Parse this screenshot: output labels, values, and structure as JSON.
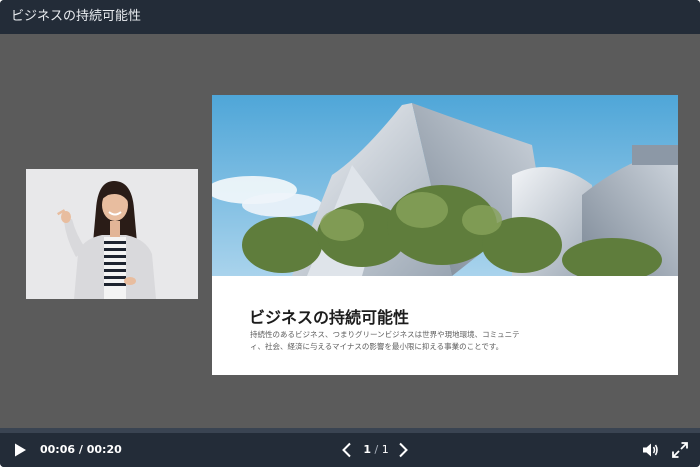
{
  "window": {
    "title": "ビジネスの持続可能性"
  },
  "slide": {
    "title": "ビジネスの持続可能性",
    "body": "持続性のあるビジネス、つまりグリーンビジネスは世界や現地環境、コミュニティ、社会、経済に与えるマイナスの影響を最小限に抑える事業のことです。",
    "image": "modern-architecture-photo"
  },
  "player": {
    "current_time": "00:06",
    "time_separator": "/",
    "duration": "00:20",
    "progress": 0.3,
    "page_current": "1",
    "page_separator": "/",
    "page_total": "1"
  },
  "icons": {
    "play": "play-icon",
    "prev": "chevron-left-icon",
    "next": "chevron-right-icon",
    "volume": "volume-icon",
    "fullscreen": "fullscreen-icon"
  },
  "colors": {
    "chrome": "#232c38",
    "stage": "#5b5b5b",
    "slide_bg": "#ffffff",
    "title_text": "#1c1c1c"
  }
}
